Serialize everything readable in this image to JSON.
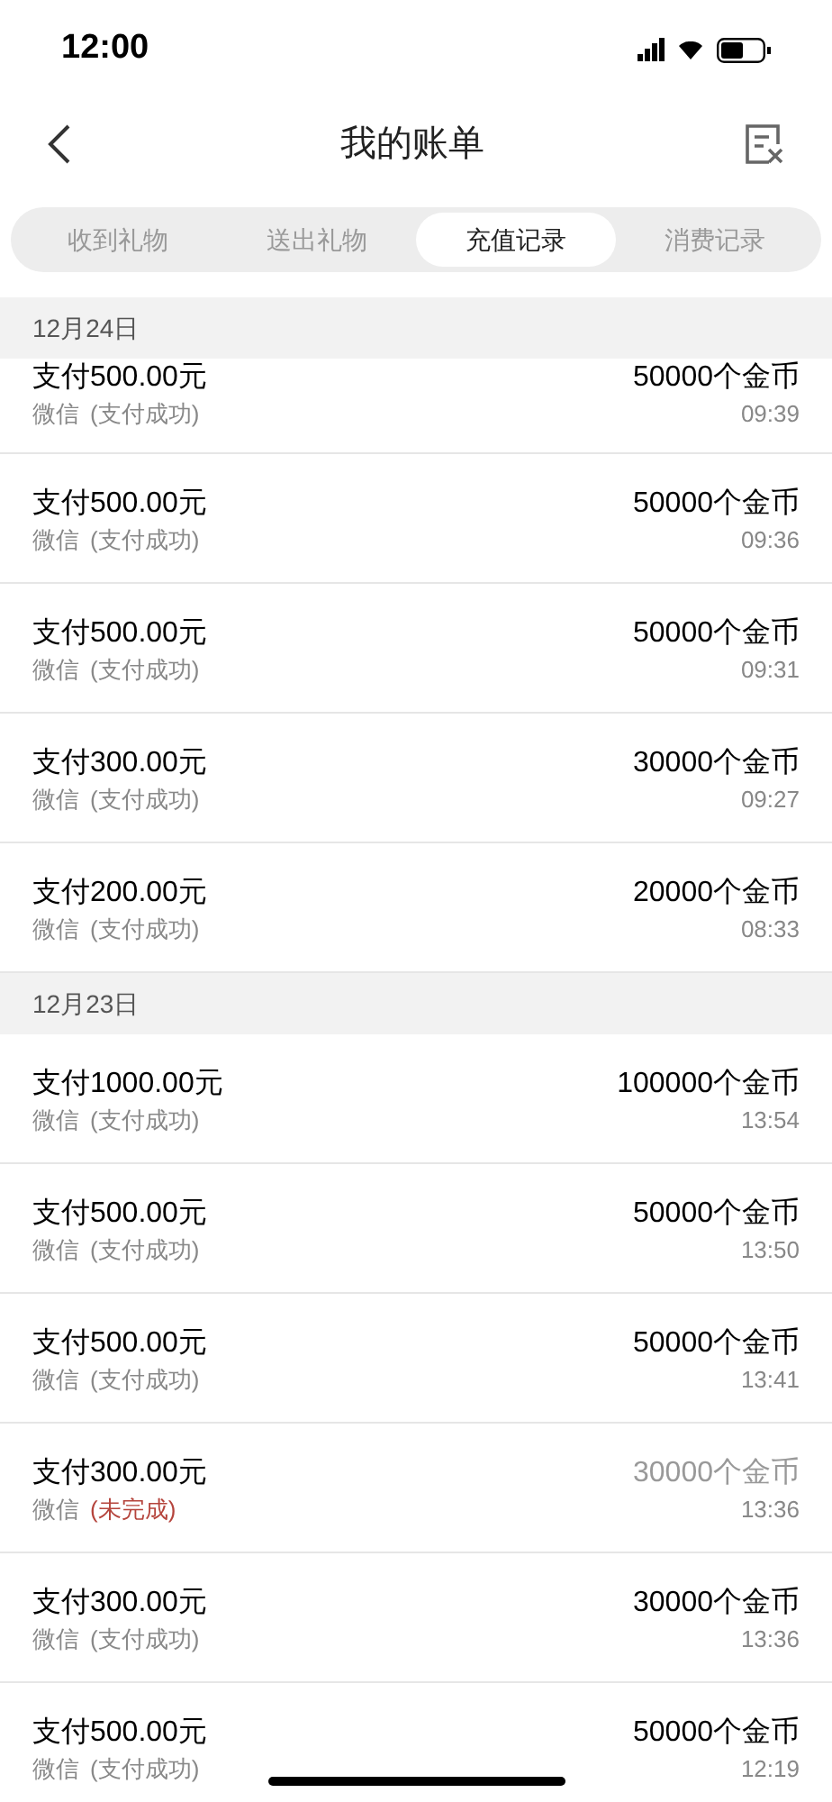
{
  "status_bar": {
    "time": "12:00"
  },
  "header": {
    "title": "我的账单"
  },
  "tabs": [
    {
      "label": "收到礼物",
      "selected": false
    },
    {
      "label": "送出礼物",
      "selected": false
    },
    {
      "label": "充值记录",
      "selected": true
    },
    {
      "label": "消费记录",
      "selected": false
    }
  ],
  "sections": [
    {
      "date": "12月24日",
      "records": [
        {
          "amount": "支付500.00元",
          "method": "微信",
          "status": "(支付成功)",
          "completed": true,
          "coins": "50000个金币",
          "time": "09:39"
        },
        {
          "amount": "支付500.00元",
          "method": "微信",
          "status": "(支付成功)",
          "completed": true,
          "coins": "50000个金币",
          "time": "09:36"
        },
        {
          "amount": "支付500.00元",
          "method": "微信",
          "status": "(支付成功)",
          "completed": true,
          "coins": "50000个金币",
          "time": "09:31"
        },
        {
          "amount": "支付300.00元",
          "method": "微信",
          "status": "(支付成功)",
          "completed": true,
          "coins": "30000个金币",
          "time": "09:27"
        },
        {
          "amount": "支付200.00元",
          "method": "微信",
          "status": "(支付成功)",
          "completed": true,
          "coins": "20000个金币",
          "time": "08:33"
        }
      ]
    },
    {
      "date": "12月23日",
      "records": [
        {
          "amount": "支付1000.00元",
          "method": "微信",
          "status": "(支付成功)",
          "completed": true,
          "coins": "100000个金币",
          "time": "13:54"
        },
        {
          "amount": "支付500.00元",
          "method": "微信",
          "status": "(支付成功)",
          "completed": true,
          "coins": "50000个金币",
          "time": "13:50"
        },
        {
          "amount": "支付500.00元",
          "method": "微信",
          "status": "(支付成功)",
          "completed": true,
          "coins": "50000个金币",
          "time": "13:41"
        },
        {
          "amount": "支付300.00元",
          "method": "微信",
          "status": "(未完成)",
          "completed": false,
          "coins": "30000个金币",
          "time": "13:36"
        },
        {
          "amount": "支付300.00元",
          "method": "微信",
          "status": "(支付成功)",
          "completed": true,
          "coins": "30000个金币",
          "time": "13:36"
        },
        {
          "amount": "支付500.00元",
          "method": "微信",
          "status": "(支付成功)",
          "completed": true,
          "coins": "50000个金币",
          "time": "12:19"
        }
      ]
    }
  ]
}
